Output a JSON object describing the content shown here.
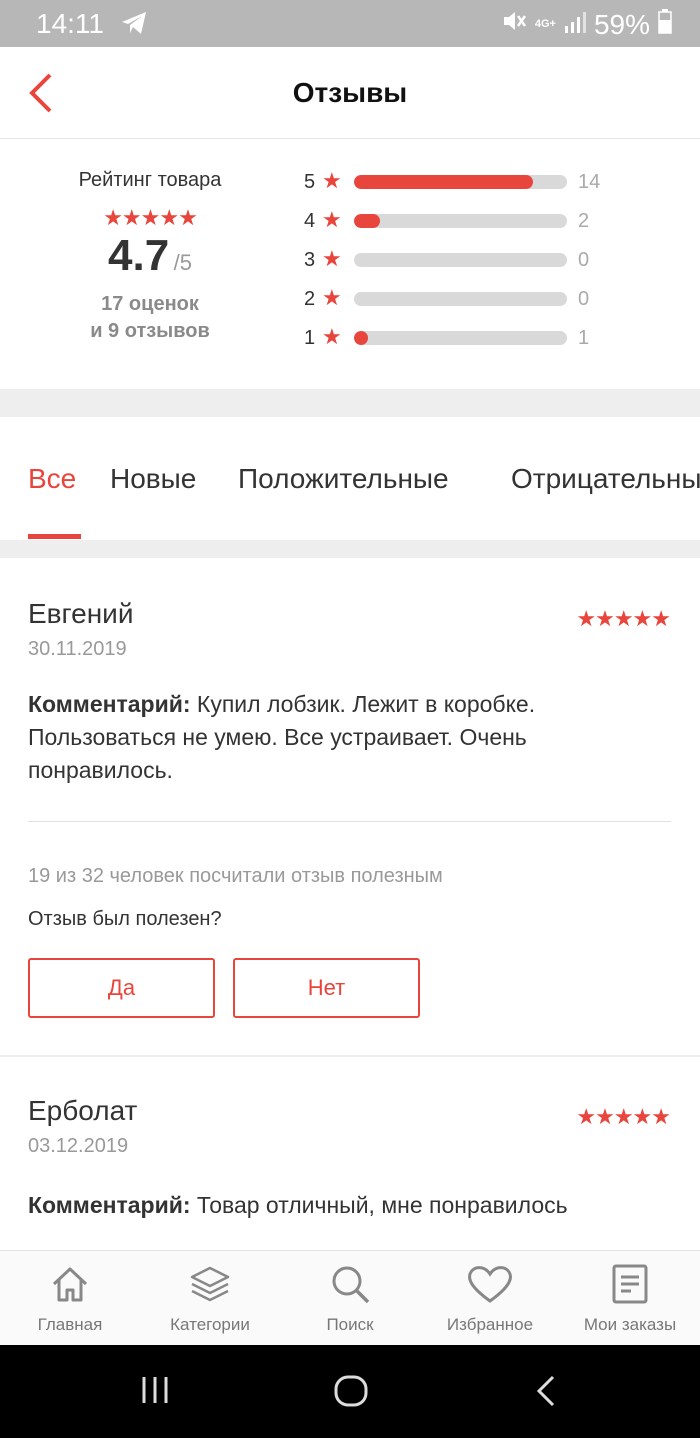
{
  "status_bar": {
    "time": "14:11",
    "network": "4G+",
    "battery": "59%"
  },
  "header": {
    "title": "Отзывы"
  },
  "summary": {
    "label": "Рейтинг товара",
    "stars": "★★★★★",
    "score": "4.7",
    "score_max": "/5",
    "ratings_count": "17 оценок",
    "reviews_count": "и 9 отзывов",
    "distribution": [
      {
        "stars": "5",
        "count": "14",
        "fraction": 0.84
      },
      {
        "stars": "4",
        "count": "2",
        "fraction": 0.12
      },
      {
        "stars": "3",
        "count": "0",
        "fraction": 0
      },
      {
        "stars": "2",
        "count": "0",
        "fraction": 0
      },
      {
        "stars": "1",
        "count": "1",
        "fraction": 0.06
      }
    ]
  },
  "tabs": [
    {
      "label": "Все",
      "active": true
    },
    {
      "label": "Новые",
      "active": false
    },
    {
      "label": "Положительные",
      "active": false
    },
    {
      "label": "Отрицательные",
      "active": false
    }
  ],
  "reviews": [
    {
      "author": "Евгений",
      "date": "30.11.2019",
      "stars": "★★★★★",
      "comment_label": "Комментарий:",
      "comment_text": " Купил лобзик. Лежит в коробке. Пользоваться не умею. Все устраивает. Очень понравилось.",
      "helpful_stat": "19 из 32 человек посчитали отзыв полезным",
      "question": "Отзыв был полезен?",
      "yes_label": "Да",
      "no_label": "Нет"
    },
    {
      "author": "Ерболат",
      "date": "03.12.2019",
      "stars": "★★★★★",
      "comment_label": "Комментарий:",
      "comment_text": " Товар отличный, мне понравилось"
    }
  ],
  "bottom_nav": [
    {
      "label": "Главная",
      "icon": "home-icon"
    },
    {
      "label": "Категории",
      "icon": "layers-icon"
    },
    {
      "label": "Поиск",
      "icon": "search-icon"
    },
    {
      "label": "Избранное",
      "icon": "heart-icon"
    },
    {
      "label": "Мои заказы",
      "icon": "orders-icon"
    }
  ],
  "colors": {
    "accent": "#e8453c",
    "status_bar": "#b7b7b7",
    "divider": "#eeeeee"
  }
}
